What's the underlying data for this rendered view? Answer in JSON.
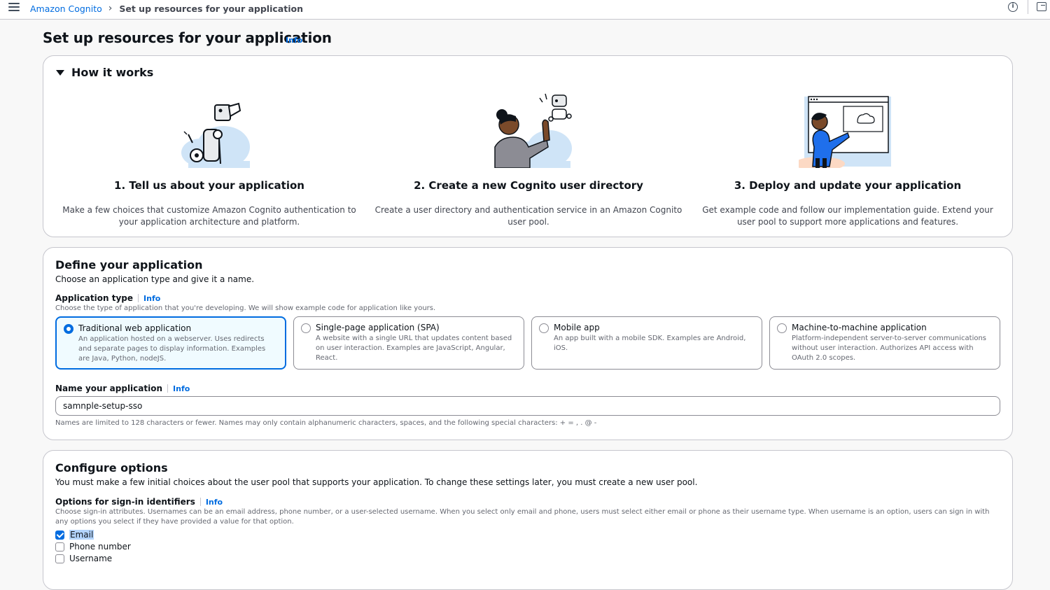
{
  "breadcrumb": {
    "root": "Amazon Cognito",
    "current": "Set up resources for your application"
  },
  "page": {
    "title": "Set up resources for your application",
    "info": "Info"
  },
  "how_it_works": {
    "title": "How it works",
    "steps": [
      {
        "title": "1. Tell us about your application",
        "description": "Make a few choices that customize Amazon Cognito authentication to your application architecture and platform."
      },
      {
        "title": "2. Create a new Cognito user directory",
        "description": "Create a user directory and authentication service in an Amazon Cognito user pool."
      },
      {
        "title": "3. Deploy and update your application",
        "description": "Get example code and follow our implementation guide. Extend your user pool to support more applications and features."
      }
    ]
  },
  "define": {
    "title": "Define your application",
    "description": "Choose an application type and give it a name.",
    "app_type_label": "Application type",
    "app_type_info": "Info",
    "app_type_description": "Choose the type of application that you're developing. We will show example code for application like yours.",
    "types": [
      {
        "title": "Traditional web application",
        "description": "An application hosted on a webserver. Uses redirects and separate pages to display information. Examples are Java, Python, nodeJS.",
        "selected": true
      },
      {
        "title": "Single-page application (SPA)",
        "description": "A website with a single URL that updates content based on user interaction. Examples are JavaScript, Angular, React.",
        "selected": false
      },
      {
        "title": "Mobile app",
        "description": "An app built with a mobile SDK. Examples are Android, iOS.",
        "selected": false
      },
      {
        "title": "Machine-to-machine application",
        "description": "Platform-independent server-to-server communications without user interaction. Authorizes API access with OAuth 2.0 scopes.",
        "selected": false
      }
    ],
    "name_label": "Name your application",
    "name_info": "Info",
    "name_value": "samnple-setup-sso",
    "name_constraint": "Names are limited to 128 characters or fewer. Names may only contain alphanumeric characters, spaces, and the following special characters: + = , . @ -"
  },
  "configure": {
    "title": "Configure options",
    "description": "You must make a few initial choices about the user pool that supports your application. To change these settings later, you must create a new user pool.",
    "signin_label": "Options for sign-in identifiers",
    "signin_info": "Info",
    "signin_description": "Choose sign-in attributes. Usernames can be an email address, phone number, or a user-selected username. When you select only email and phone, users must select either email or phone as their username type. When username is an option, users can sign in with any options you select if they have provided a value for that option.",
    "options": [
      {
        "label": "Email",
        "checked": true
      },
      {
        "label": "Phone number",
        "checked": false
      },
      {
        "label": "Username",
        "checked": false
      }
    ]
  },
  "colors": {
    "accent": "#006ce0",
    "border": "#c6c6cd",
    "selected_bg": "#f0fbff"
  }
}
